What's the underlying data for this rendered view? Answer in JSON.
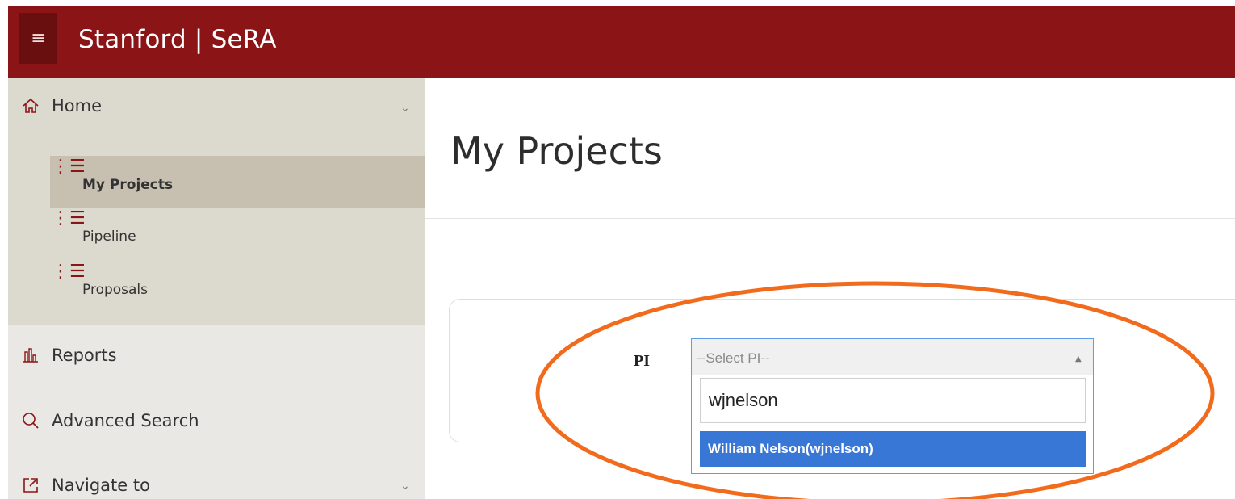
{
  "header": {
    "menu_icon": "hamburger-icon",
    "app_title": "Stanford | SeRA",
    "brand_color": "#8b1516"
  },
  "sidebar": {
    "home": {
      "label": "Home",
      "icon": "home-icon"
    },
    "sub_items": [
      {
        "label": "My Projects",
        "icon": "list-icon",
        "active": true
      },
      {
        "label": "Pipeline",
        "icon": "numbered-list-icon",
        "active": false
      },
      {
        "label": "Proposals",
        "icon": "list-icon",
        "active": false
      }
    ],
    "reports": {
      "label": "Reports",
      "icon": "bar-chart-icon"
    },
    "advanced_search": {
      "label": "Advanced Search",
      "icon": "search-icon"
    },
    "navigate_to": {
      "label": "Navigate to",
      "icon": "external-link-icon"
    }
  },
  "main": {
    "page_title": "My Projects",
    "filter": {
      "pi_label": "PI",
      "placeholder": "--Select PI--",
      "search_value": "wjnelson",
      "options": [
        "William Nelson(wjnelson)"
      ]
    }
  },
  "annotation": {
    "color": "#f26a1b"
  }
}
